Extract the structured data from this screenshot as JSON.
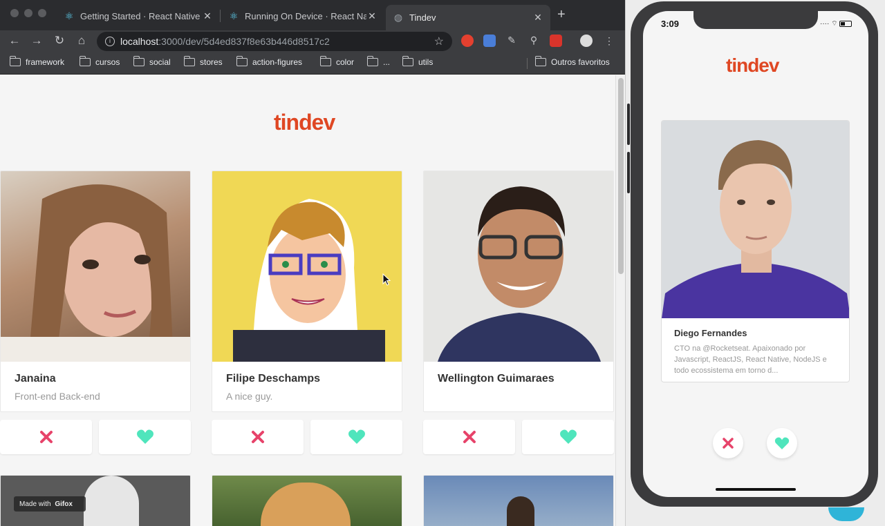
{
  "browser": {
    "tabs": [
      {
        "label": "Getting Started · React Native",
        "icon": "react-icon",
        "active": false
      },
      {
        "label": "Running On Device · React Nat",
        "icon": "react-icon",
        "active": false
      },
      {
        "label": "Tindev",
        "icon": "globe-icon",
        "active": true
      }
    ],
    "address": {
      "host": "localhost",
      "path": ":3000/dev/5d4ed837f8e63b446d8517c2"
    },
    "bookmarks": [
      "framework",
      "cursos",
      "social",
      "stores",
      "action-figures",
      "color",
      "...",
      "utils"
    ],
    "other_bookmarks": "Outros favoritos"
  },
  "page": {
    "logo": "tindev",
    "devs": [
      {
        "name": "Janaina",
        "bio": "Front-end Back-end"
      },
      {
        "name": "Filipe Deschamps",
        "bio": "A nice guy."
      },
      {
        "name": "Wellington Guimaraes",
        "bio": ""
      }
    ],
    "gifox": {
      "prefix": "Made with",
      "brand": "Gifox"
    }
  },
  "phone": {
    "time": "3:09",
    "logo": "tindev",
    "card": {
      "name": "Diego Fernandes",
      "bio": "CTO na @Rocketseat. Apaixonado por Javascript, ReactJS, React Native, NodeJS e todo ecossistema em torno d..."
    }
  },
  "colors": {
    "accent": "#df4723",
    "dislike": "#e7436a",
    "like": "#4fe5bc"
  }
}
